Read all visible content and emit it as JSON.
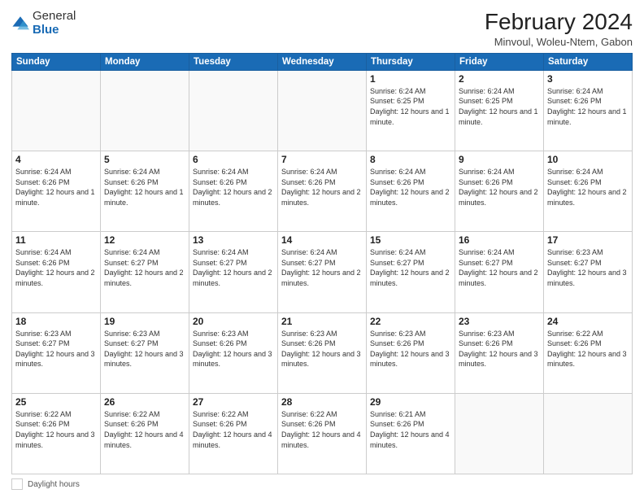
{
  "logo": {
    "general": "General",
    "blue": "Blue"
  },
  "title": "February 2024",
  "subtitle": "Minvoul, Woleu-Ntem, Gabon",
  "days_of_week": [
    "Sunday",
    "Monday",
    "Tuesday",
    "Wednesday",
    "Thursday",
    "Friday",
    "Saturday"
  ],
  "weeks": [
    [
      {
        "day": "",
        "info": ""
      },
      {
        "day": "",
        "info": ""
      },
      {
        "day": "",
        "info": ""
      },
      {
        "day": "",
        "info": ""
      },
      {
        "day": "1",
        "info": "Sunrise: 6:24 AM\nSunset: 6:25 PM\nDaylight: 12 hours\nand 1 minute."
      },
      {
        "day": "2",
        "info": "Sunrise: 6:24 AM\nSunset: 6:25 PM\nDaylight: 12 hours\nand 1 minute."
      },
      {
        "day": "3",
        "info": "Sunrise: 6:24 AM\nSunset: 6:26 PM\nDaylight: 12 hours\nand 1 minute."
      }
    ],
    [
      {
        "day": "4",
        "info": "Sunrise: 6:24 AM\nSunset: 6:26 PM\nDaylight: 12 hours\nand 1 minute."
      },
      {
        "day": "5",
        "info": "Sunrise: 6:24 AM\nSunset: 6:26 PM\nDaylight: 12 hours\nand 1 minute."
      },
      {
        "day": "6",
        "info": "Sunrise: 6:24 AM\nSunset: 6:26 PM\nDaylight: 12 hours\nand 2 minutes."
      },
      {
        "day": "7",
        "info": "Sunrise: 6:24 AM\nSunset: 6:26 PM\nDaylight: 12 hours\nand 2 minutes."
      },
      {
        "day": "8",
        "info": "Sunrise: 6:24 AM\nSunset: 6:26 PM\nDaylight: 12 hours\nand 2 minutes."
      },
      {
        "day": "9",
        "info": "Sunrise: 6:24 AM\nSunset: 6:26 PM\nDaylight: 12 hours\nand 2 minutes."
      },
      {
        "day": "10",
        "info": "Sunrise: 6:24 AM\nSunset: 6:26 PM\nDaylight: 12 hours\nand 2 minutes."
      }
    ],
    [
      {
        "day": "11",
        "info": "Sunrise: 6:24 AM\nSunset: 6:26 PM\nDaylight: 12 hours\nand 2 minutes."
      },
      {
        "day": "12",
        "info": "Sunrise: 6:24 AM\nSunset: 6:27 PM\nDaylight: 12 hours\nand 2 minutes."
      },
      {
        "day": "13",
        "info": "Sunrise: 6:24 AM\nSunset: 6:27 PM\nDaylight: 12 hours\nand 2 minutes."
      },
      {
        "day": "14",
        "info": "Sunrise: 6:24 AM\nSunset: 6:27 PM\nDaylight: 12 hours\nand 2 minutes."
      },
      {
        "day": "15",
        "info": "Sunrise: 6:24 AM\nSunset: 6:27 PM\nDaylight: 12 hours\nand 2 minutes."
      },
      {
        "day": "16",
        "info": "Sunrise: 6:24 AM\nSunset: 6:27 PM\nDaylight: 12 hours\nand 2 minutes."
      },
      {
        "day": "17",
        "info": "Sunrise: 6:23 AM\nSunset: 6:27 PM\nDaylight: 12 hours\nand 3 minutes."
      }
    ],
    [
      {
        "day": "18",
        "info": "Sunrise: 6:23 AM\nSunset: 6:27 PM\nDaylight: 12 hours\nand 3 minutes."
      },
      {
        "day": "19",
        "info": "Sunrise: 6:23 AM\nSunset: 6:27 PM\nDaylight: 12 hours\nand 3 minutes."
      },
      {
        "day": "20",
        "info": "Sunrise: 6:23 AM\nSunset: 6:26 PM\nDaylight: 12 hours\nand 3 minutes."
      },
      {
        "day": "21",
        "info": "Sunrise: 6:23 AM\nSunset: 6:26 PM\nDaylight: 12 hours\nand 3 minutes."
      },
      {
        "day": "22",
        "info": "Sunrise: 6:23 AM\nSunset: 6:26 PM\nDaylight: 12 hours\nand 3 minutes."
      },
      {
        "day": "23",
        "info": "Sunrise: 6:23 AM\nSunset: 6:26 PM\nDaylight: 12 hours\nand 3 minutes."
      },
      {
        "day": "24",
        "info": "Sunrise: 6:22 AM\nSunset: 6:26 PM\nDaylight: 12 hours\nand 3 minutes."
      }
    ],
    [
      {
        "day": "25",
        "info": "Sunrise: 6:22 AM\nSunset: 6:26 PM\nDaylight: 12 hours\nand 3 minutes."
      },
      {
        "day": "26",
        "info": "Sunrise: 6:22 AM\nSunset: 6:26 PM\nDaylight: 12 hours\nand 4 minutes."
      },
      {
        "day": "27",
        "info": "Sunrise: 6:22 AM\nSunset: 6:26 PM\nDaylight: 12 hours\nand 4 minutes."
      },
      {
        "day": "28",
        "info": "Sunrise: 6:22 AM\nSunset: 6:26 PM\nDaylight: 12 hours\nand 4 minutes."
      },
      {
        "day": "29",
        "info": "Sunrise: 6:21 AM\nSunset: 6:26 PM\nDaylight: 12 hours\nand 4 minutes."
      },
      {
        "day": "",
        "info": ""
      },
      {
        "day": "",
        "info": ""
      }
    ]
  ],
  "legend": {
    "box_label": "Daylight hours"
  }
}
